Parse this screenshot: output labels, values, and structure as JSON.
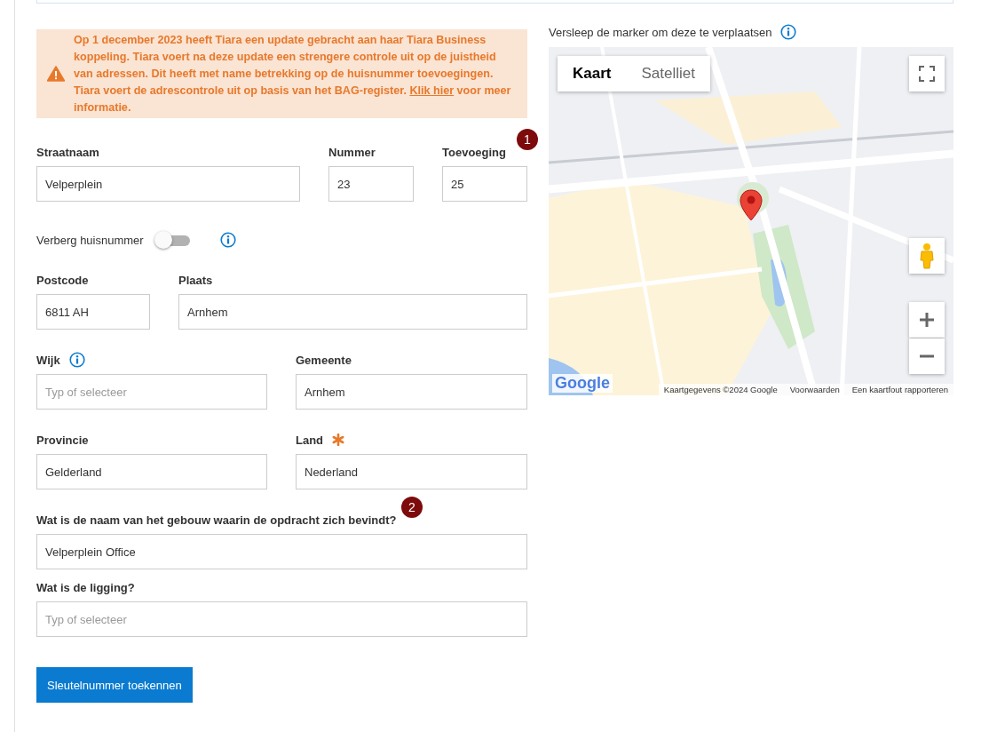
{
  "notice": {
    "text": "Op 1 december 2023 heeft Tiara een update gebracht aan haar Tiara Business koppeling. Tiara voert na deze update een strengere controle uit op de juistheid van adressen. Dit heeft met name betrekking op de huisnummer toevoegingen. Tiara voert de adrescontrole uit op basis van het BAG-register.",
    "link": "Klik hier",
    "text_after": "voor meer informatie."
  },
  "address_rows": [
    {
      "fields": [
        {
          "label": "Straatnaam",
          "value": "Velperplein"
        },
        {
          "label": "Nummer",
          "value": "23"
        },
        {
          "label": "Toevoeging",
          "value": "25",
          "badge": "1"
        }
      ]
    },
    {
      "toggle": {
        "label": "Verberg huisnummer",
        "on": false,
        "info": true
      }
    },
    {
      "fields": [
        {
          "label": "Postcode",
          "value": "6811 AH"
        },
        {
          "label": "Plaats",
          "value": "Arnhem"
        }
      ]
    },
    {
      "fields": [
        {
          "label": "Wijk",
          "placeholder": "Typ of selecteer",
          "info": true
        },
        {
          "label": "Gemeente",
          "value": "Arnhem"
        }
      ]
    },
    {
      "fields": [
        {
          "label": "Provincie",
          "value": "Gelderland"
        },
        {
          "label": "Land",
          "value": "Nederland",
          "required": true
        }
      ]
    },
    {
      "fields": [
        {
          "label": "Wat is de naam van het gebouw waarin de opdracht zich bevindt?",
          "value": "Velperplein Office",
          "badge": "2"
        }
      ]
    },
    {
      "fields": [
        {
          "label": "Wat is de ligging?",
          "placeholder": "Typ of selecteer"
        }
      ]
    }
  ],
  "submit_button": "Sleutelnummer toekennen",
  "map": {
    "caption": "Versleep de marker om deze te verplaatsen",
    "tabs": [
      {
        "label": "Kaart",
        "selected": true
      },
      {
        "label": "Satelliet",
        "selected": false
      }
    ],
    "logo": "Google",
    "attribution": [
      "Kaartgegevens ©2024 Google",
      "Voorwaarden",
      "Een kaartfout rapporteren"
    ]
  }
}
